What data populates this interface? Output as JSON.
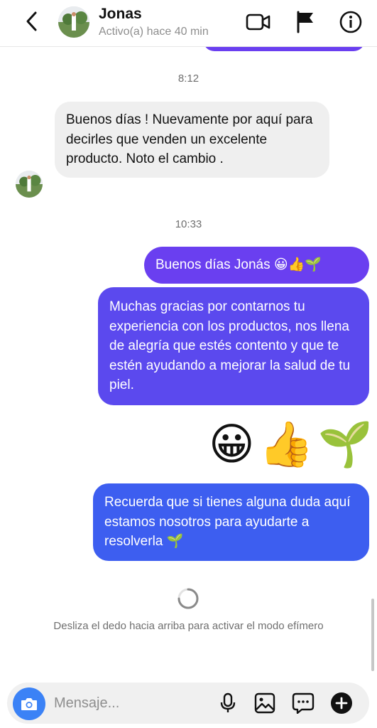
{
  "header": {
    "name": "Jonas",
    "status": "Activo(a) hace 40 min",
    "icons": [
      "back-chevron-icon",
      "video-call-icon",
      "flag-icon",
      "info-icon"
    ]
  },
  "conversation": {
    "time_1": "8:12",
    "incoming_1": "Buenos días ! Nuevamente por aquí para decirles que venden un excelente producto. Noto el cambio .",
    "time_2": "10:33",
    "outgoing_1": "Buenos días Jonás 😀👍🌱",
    "outgoing_2": "Muchas gracias por contarnos tu experiencia con los productos, nos llena de alegría que estés contento y que te estén ayudando a mejorar la salud de tu piel.",
    "emojis": {
      "grin": "😀",
      "thumbs": "👍",
      "sprout": "🌱"
    },
    "outgoing_3": "Recuerda que si tienes alguna duda aquí estamos nosotros para ayudarte a resolverla 🌱"
  },
  "footer_hint": "Desliza el dedo hacia arriba para activar el modo efímero",
  "composer": {
    "placeholder": "Mensaje...",
    "icons": [
      "camera-icon",
      "microphone-icon",
      "gallery-icon",
      "sticker-icon",
      "plus-icon"
    ]
  },
  "colors": {
    "bubble_purple": "#6a3ff0",
    "bubble_indigo": "#5b49ee",
    "bubble_blue": "#3d5ef0",
    "incoming_gray": "#efefef",
    "camera_blue": "#3b82f6"
  }
}
